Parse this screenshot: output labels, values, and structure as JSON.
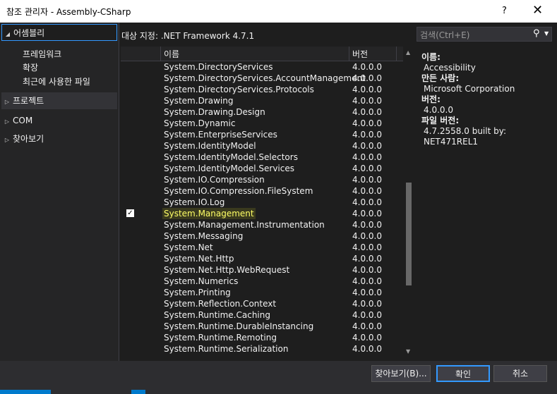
{
  "window": {
    "title": "참조 관리자 - Assembly-CSharp",
    "help": "?",
    "close": "✕"
  },
  "nav": {
    "assemblies": "어셈블리",
    "framework": "프레임워크",
    "extensions": "확장",
    "recent": "최근에 사용한 파일",
    "projects": "프로젝트",
    "com": "COM",
    "browse": "찾아보기"
  },
  "target": "대상 지정: .NET Framework 4.7.1",
  "grid": {
    "col_name": "이름",
    "col_version": "버전",
    "rows": [
      {
        "name": "System.DirectoryServices",
        "version": "4.0.0.0",
        "checked": false
      },
      {
        "name": "System.DirectoryServices.AccountManagement",
        "version": "4.0.0.0",
        "checked": false
      },
      {
        "name": "System.DirectoryServices.Protocols",
        "version": "4.0.0.0",
        "checked": false
      },
      {
        "name": "System.Drawing",
        "version": "4.0.0.0",
        "checked": false
      },
      {
        "name": "System.Drawing.Design",
        "version": "4.0.0.0",
        "checked": false
      },
      {
        "name": "System.Dynamic",
        "version": "4.0.0.0",
        "checked": false
      },
      {
        "name": "System.EnterpriseServices",
        "version": "4.0.0.0",
        "checked": false
      },
      {
        "name": "System.IdentityModel",
        "version": "4.0.0.0",
        "checked": false
      },
      {
        "name": "System.IdentityModel.Selectors",
        "version": "4.0.0.0",
        "checked": false
      },
      {
        "name": "System.IdentityModel.Services",
        "version": "4.0.0.0",
        "checked": false
      },
      {
        "name": "System.IO.Compression",
        "version": "4.0.0.0",
        "checked": false
      },
      {
        "name": "System.IO.Compression.FileSystem",
        "version": "4.0.0.0",
        "checked": false
      },
      {
        "name": "System.IO.Log",
        "version": "4.0.0.0",
        "checked": false
      },
      {
        "name": "System.Management",
        "version": "4.0.0.0",
        "checked": true
      },
      {
        "name": "System.Management.Instrumentation",
        "version": "4.0.0.0",
        "checked": false
      },
      {
        "name": "System.Messaging",
        "version": "4.0.0.0",
        "checked": false
      },
      {
        "name": "System.Net",
        "version": "4.0.0.0",
        "checked": false
      },
      {
        "name": "System.Net.Http",
        "version": "4.0.0.0",
        "checked": false
      },
      {
        "name": "System.Net.Http.WebRequest",
        "version": "4.0.0.0",
        "checked": false
      },
      {
        "name": "System.Numerics",
        "version": "4.0.0.0",
        "checked": false
      },
      {
        "name": "System.Printing",
        "version": "4.0.0.0",
        "checked": false
      },
      {
        "name": "System.Reflection.Context",
        "version": "4.0.0.0",
        "checked": false
      },
      {
        "name": "System.Runtime.Caching",
        "version": "4.0.0.0",
        "checked": false
      },
      {
        "name": "System.Runtime.DurableInstancing",
        "version": "4.0.0.0",
        "checked": false
      },
      {
        "name": "System.Runtime.Remoting",
        "version": "4.0.0.0",
        "checked": false
      },
      {
        "name": "System.Runtime.Serialization",
        "version": "4.0.0.0",
        "checked": false
      }
    ]
  },
  "search": {
    "placeholder": "검색(Ctrl+E)"
  },
  "details": {
    "name_label": "이름:",
    "name_value": "Accessibility",
    "author_label": "만든 사람:",
    "author_value": "Microsoft Corporation",
    "version_label": "버전:",
    "version_value": "4.0.0.0",
    "file_version_label": "파일 버전:",
    "file_version_value": "4.7.2558.0 built by: NET471REL1"
  },
  "buttons": {
    "browse": "찾아보기(B)...",
    "ok": "확인",
    "cancel": "취소"
  }
}
